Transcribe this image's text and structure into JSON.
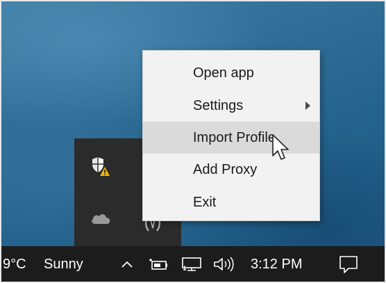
{
  "context_menu": {
    "items": [
      {
        "label": "Open app",
        "has_submenu": false,
        "hovered": false
      },
      {
        "label": "Settings",
        "has_submenu": true,
        "hovered": false
      },
      {
        "label": "Import Profile",
        "has_submenu": false,
        "hovered": true
      },
      {
        "label": "Add Proxy",
        "has_submenu": false,
        "hovered": false
      },
      {
        "label": "Exit",
        "has_submenu": false,
        "hovered": false
      }
    ]
  },
  "tray_flyout": {
    "icons": [
      "windows-security-warning-icon",
      "onedrive-cloud-icon",
      "app-tray-icon"
    ]
  },
  "taskbar": {
    "weather_temp": "9°C",
    "weather_condition": "Sunny",
    "clock_time": "3:12 PM",
    "icons": [
      "show-hidden-icons-chevron",
      "battery-icon",
      "network-icon",
      "volume-icon",
      "action-center-icon"
    ]
  },
  "colors": {
    "menu_background": "#f2f2f2",
    "menu_hover": "#dadada",
    "taskbar": "#1c1c1c",
    "flyout": "#2b2b2b",
    "warning_badge": "#f2b600"
  }
}
